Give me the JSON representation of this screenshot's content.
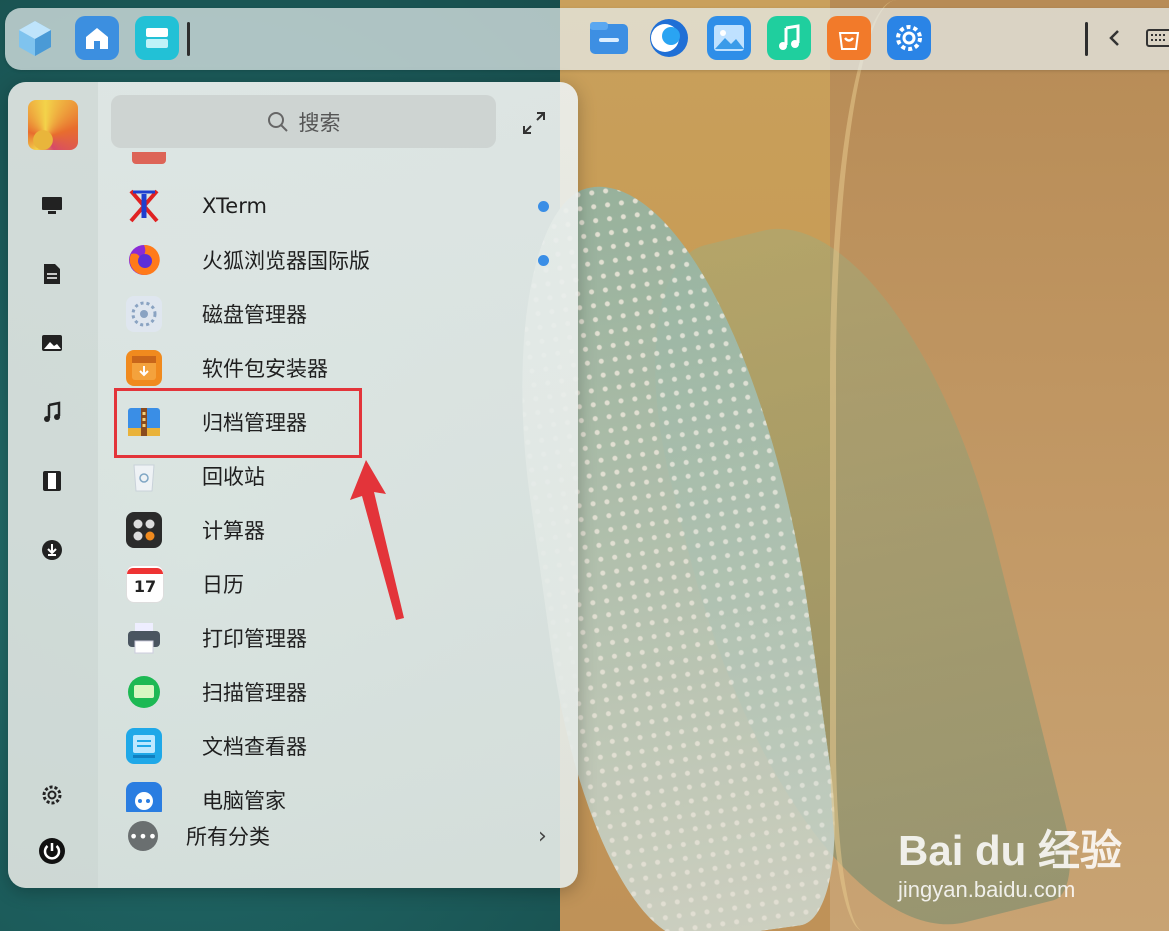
{
  "taskbar": {
    "left_icons": [
      "app-launcher-icon",
      "home-icon",
      "multitask-view-icon"
    ],
    "center_icons": [
      "file-manager-icon",
      "browser-icon",
      "image-viewer-icon",
      "music-icon",
      "app-store-icon",
      "settings-icon"
    ],
    "right_icons": [
      "collapse-chevron-icon",
      "keyboard-icon"
    ]
  },
  "launcher": {
    "search_placeholder": "搜索",
    "sidebar": [
      "computer-icon",
      "documents-icon",
      "pictures-icon",
      "music-icon",
      "videos-icon",
      "downloads-icon",
      "settings-icon",
      "power-icon"
    ],
    "apps": [
      {
        "label": "XTerm",
        "icon": "xterm-icon",
        "dot": true
      },
      {
        "label": "火狐浏览器国际版",
        "icon": "firefox-icon",
        "dot": true
      },
      {
        "label": "磁盘管理器",
        "icon": "disk-manager-icon",
        "dot": false
      },
      {
        "label": "软件包安装器",
        "icon": "package-installer-icon",
        "dot": false
      },
      {
        "label": "归档管理器",
        "icon": "archive-manager-icon",
        "dot": false
      },
      {
        "label": "回收站",
        "icon": "trash-icon",
        "dot": false
      },
      {
        "label": "计算器",
        "icon": "calculator-icon",
        "dot": false
      },
      {
        "label": "日历",
        "icon": "calendar-icon",
        "dot": false
      },
      {
        "label": "打印管理器",
        "icon": "printer-icon",
        "dot": false
      },
      {
        "label": "扫描管理器",
        "icon": "scanner-icon",
        "dot": false
      },
      {
        "label": "文档查看器",
        "icon": "document-viewer-icon",
        "dot": false
      },
      {
        "label": "电脑管家",
        "icon": "pc-manager-icon",
        "dot": false
      }
    ],
    "calendar_day": "17",
    "all_categories_label": "所有分类"
  },
  "watermark": {
    "brand": "Bai du 经验",
    "sub": "jingyan.baidu.com"
  },
  "colors": {
    "highlight": "#e3343a",
    "accent_dot": "#3a8ee6"
  }
}
